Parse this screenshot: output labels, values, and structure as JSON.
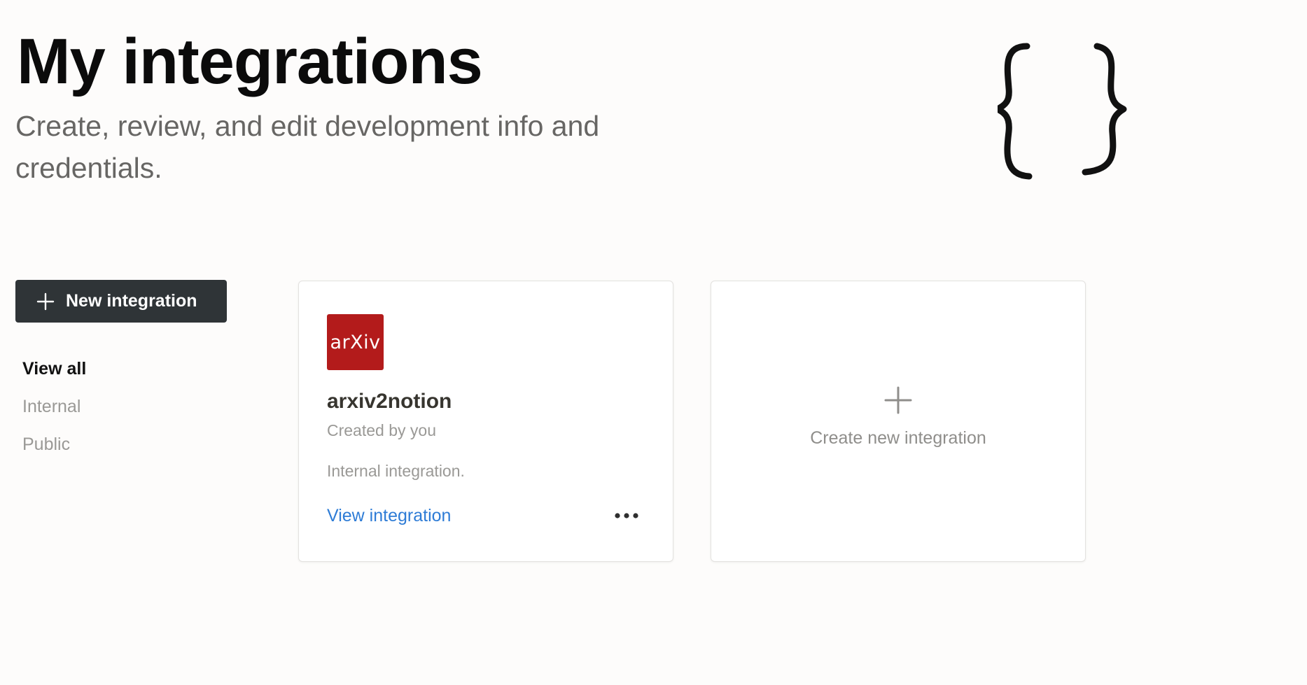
{
  "header": {
    "title": "My integrations",
    "subtitle": "Create, review, and edit development info and credentials.",
    "illustration": "curly-braces-icon"
  },
  "sidebar": {
    "new_button_label": "New integration",
    "new_button_icon": "plus-icon",
    "filters": [
      {
        "label": "View all",
        "active": true
      },
      {
        "label": "Internal",
        "active": false
      },
      {
        "label": "Public",
        "active": false
      }
    ]
  },
  "integrations": [
    {
      "logo_text": "arXiv",
      "logo_color": "#b31b1b",
      "name": "arxiv2notion",
      "creator": "Created by you",
      "type": "Internal integration.",
      "link_label": "View integration",
      "menu_icon": "more-horizontal-icon"
    }
  ],
  "create_card": {
    "label": "Create new integration",
    "icon": "plus-icon"
  },
  "colors": {
    "button_bg": "#2f3437",
    "link": "#2e7cd6",
    "muted": "#9a9996",
    "arxiv_red": "#b31b1b"
  }
}
